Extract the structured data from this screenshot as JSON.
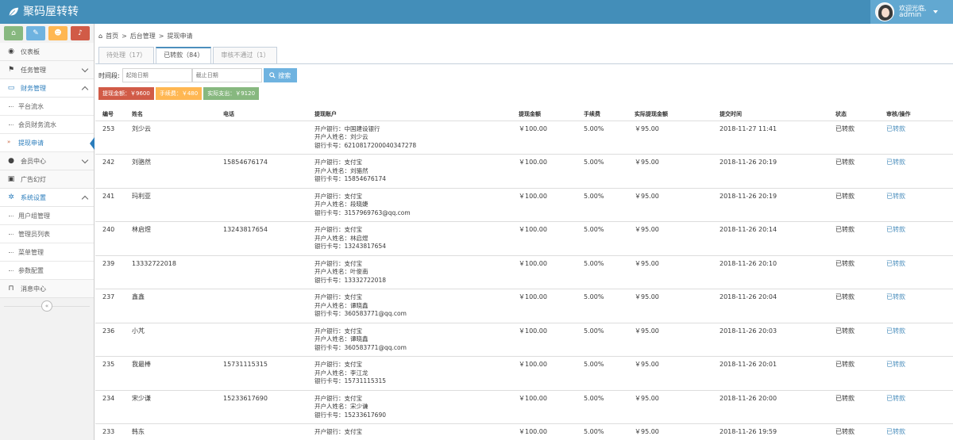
{
  "app": {
    "brand": "聚码屋转转"
  },
  "user": {
    "greeting": "欢迎光临,",
    "name": "admin"
  },
  "shortcuts": [
    {
      "icon": "home-icon",
      "glyph": "⌂",
      "color": "#87b87f"
    },
    {
      "icon": "pencil-icon",
      "glyph": "✎",
      "color": "#6fb3e0"
    },
    {
      "icon": "group-icon",
      "glyph": "☻",
      "color": "#ffb752"
    },
    {
      "icon": "bell-icon",
      "glyph": "♪",
      "color": "#d15b47"
    }
  ],
  "sidebar": {
    "dashboard": "仪表板",
    "tasks": "任务管理",
    "finance": "财务管理",
    "finance_sub": [
      "平台流水",
      "会员财务流水",
      "提现申请"
    ],
    "members": "会员中心",
    "ads": "广告幻灯",
    "system": "系统设置",
    "system_sub": [
      "用户组管理",
      "管理员列表",
      "菜单管理",
      "参数配置"
    ],
    "messages": "消息中心"
  },
  "breadcrumb": {
    "home": "首页",
    "sep": ">",
    "level2": "后台管理",
    "level3": "提现申请"
  },
  "tabs": [
    "待处理（17）",
    "已转款（84）",
    "审核不通过（1）"
  ],
  "filter": {
    "label": "时间段:",
    "start_placeholder": "起始日期",
    "end_placeholder": "截止日期",
    "search_label": "搜索"
  },
  "stats": [
    {
      "text": "提现金额：￥9600",
      "color": "#d15b47"
    },
    {
      "text": "手续费：￥480",
      "color": "#ffb752"
    },
    {
      "text": "实际支出：￥9120",
      "color": "#87b87f"
    }
  ],
  "table": {
    "headers": [
      "编号",
      "姓名",
      "电话",
      "提现账户",
      "提现金额",
      "手续费",
      "实际提现金额",
      "提交时间",
      "状态",
      "审核/操作"
    ],
    "rows": [
      {
        "id": "253",
        "name": "刘少云",
        "phone": "",
        "acct": [
          "开户银行：中国建设银行",
          "开户人姓名：刘少云",
          "银行卡号：6210817200040347278"
        ],
        "amount": "￥100.00",
        "fee": "5.00%",
        "actual": "￥95.00",
        "time": "2018-11-27 11:41",
        "status": "已转款",
        "op": "已转款"
      },
      {
        "id": "242",
        "name": "刘骆然",
        "phone": "15854676174",
        "acct": [
          "开户银行：支付宝",
          "开户人姓名：刘骆然",
          "银行卡号：15854676174"
        ],
        "amount": "￥100.00",
        "fee": "5.00%",
        "actual": "￥95.00",
        "time": "2018-11-26 20:19",
        "status": "已转款",
        "op": "已转款"
      },
      {
        "id": "241",
        "name": "玛利亚",
        "phone": "",
        "acct": [
          "开户银行：支付宝",
          "开户人姓名：段晓婕",
          "银行卡号：3157969763@qq.com"
        ],
        "amount": "￥100.00",
        "fee": "5.00%",
        "actual": "￥95.00",
        "time": "2018-11-26 20:19",
        "status": "已转款",
        "op": "已转款"
      },
      {
        "id": "240",
        "name": "林启煜",
        "phone": "13243817654",
        "acct": [
          "开户银行：支付宝",
          "开户人姓名：林启煜",
          "银行卡号：13243817654"
        ],
        "amount": "￥100.00",
        "fee": "5.00%",
        "actual": "￥95.00",
        "time": "2018-11-26 20:14",
        "status": "已转款",
        "op": "已转款"
      },
      {
        "id": "239",
        "name": "13332722018",
        "phone": "",
        "acct": [
          "开户银行：支付宝",
          "开户人姓名：叶俊南",
          "银行卡号：13332722018"
        ],
        "amount": "￥100.00",
        "fee": "5.00%",
        "actual": "￥95.00",
        "time": "2018-11-26 20:10",
        "status": "已转款",
        "op": "已转款"
      },
      {
        "id": "237",
        "name": "鑫鑫",
        "phone": "",
        "acct": [
          "开户银行：支付宝",
          "开户人姓名：谭晓鑫",
          "银行卡号：360583771@qq.com"
        ],
        "amount": "￥100.00",
        "fee": "5.00%",
        "actual": "￥95.00",
        "time": "2018-11-26 20:04",
        "status": "已转款",
        "op": "已转款"
      },
      {
        "id": "236",
        "name": "小芃",
        "phone": "",
        "acct": [
          "开户银行：支付宝",
          "开户人姓名：谭晓鑫",
          "银行卡号：360583771@qq.com"
        ],
        "amount": "￥100.00",
        "fee": "5.00%",
        "actual": "￥95.00",
        "time": "2018-11-26 20:03",
        "status": "已转款",
        "op": "已转款"
      },
      {
        "id": "235",
        "name": "我最棒",
        "phone": "15731115315",
        "acct": [
          "开户银行：支付宝",
          "开户人姓名：李江龙",
          "银行卡号：15731115315"
        ],
        "amount": "￥100.00",
        "fee": "5.00%",
        "actual": "￥95.00",
        "time": "2018-11-26 20:01",
        "status": "已转款",
        "op": "已转款"
      },
      {
        "id": "234",
        "name": "宋少谦",
        "phone": "15233617690",
        "acct": [
          "开户银行：支付宝",
          "开户人姓名：宋少谦",
          "银行卡号：15233617690"
        ],
        "amount": "￥100.00",
        "fee": "5.00%",
        "actual": "￥95.00",
        "time": "2018-11-26 20:00",
        "status": "已转款",
        "op": "已转款"
      },
      {
        "id": "233",
        "name": "韩东",
        "phone": "",
        "acct": [
          "开户银行：支付宝",
          "",
          ""
        ],
        "amount": "￥100.00",
        "fee": "5.00%",
        "actual": "￥95.00",
        "time": "2018-11-26 19:59",
        "status": "已转款",
        "op": "已转款"
      }
    ]
  }
}
